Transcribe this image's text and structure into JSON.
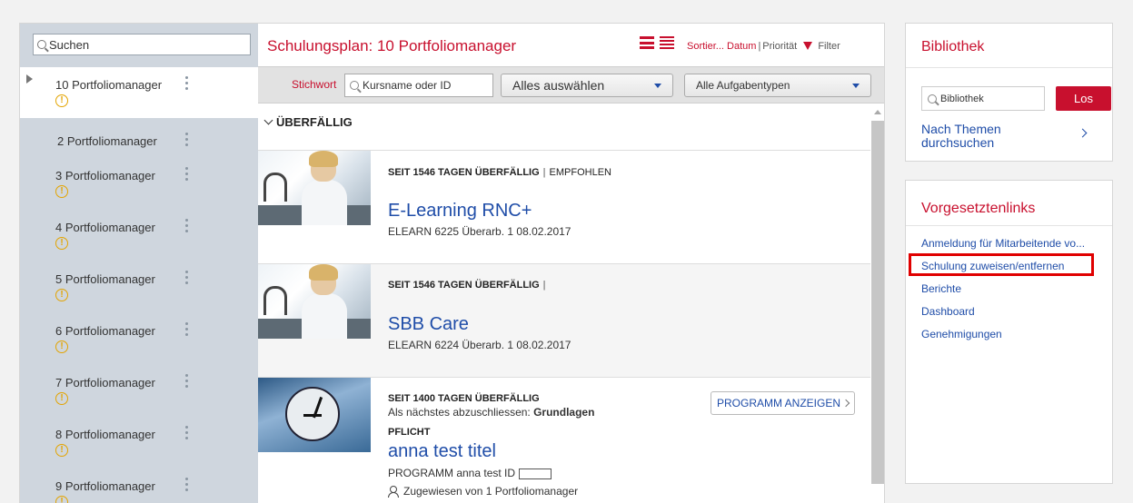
{
  "sidebar": {
    "search_placeholder": "Suchen",
    "items": [
      {
        "label": "10 Portfoliomanager",
        "warn": true,
        "active": true
      },
      {
        "label": "2 Portfoliomanager",
        "warn": false
      },
      {
        "label": "3 Portfoliomanager",
        "warn": true
      },
      {
        "label": "4 Portfoliomanager",
        "warn": true
      },
      {
        "label": "5 Portfoliomanager",
        "warn": true
      },
      {
        "label": "6 Portfoliomanager",
        "warn": true
      },
      {
        "label": "7 Portfoliomanager",
        "warn": true
      },
      {
        "label": "8 Portfoliomanager",
        "warn": true
      },
      {
        "label": "9 Portfoliomanager",
        "warn": true
      }
    ],
    "warn_glyph": "!"
  },
  "header": {
    "title": "Schulungsplan: 10 Portfoliomanager",
    "sort_label": "Sortier...",
    "sort_date": "Datum",
    "sort_priority": "Priorität",
    "filter_label": "Filter"
  },
  "toolbar": {
    "keyword_label": "Stichwort",
    "course_placeholder": "Kursname oder ID",
    "select_all": "Alles auswählen",
    "task_types": "Alle Aufgabentypen"
  },
  "section": {
    "label": "ÜBERFÄLLIG"
  },
  "courses": [
    {
      "overdue": "SEIT 1546 TAGEN ÜBERFÄLLIG",
      "sep": "|",
      "tag": "EMPFOHLEN",
      "title": "E-Learning RNC+",
      "meta": "ELEARN 6225 Überarb. 1 08.02.2017"
    },
    {
      "overdue": "SEIT 1546 TAGEN ÜBERFÄLLIG",
      "sep": "|",
      "tag": "",
      "title": "SBB Care",
      "meta": "ELEARN 6224 Überarb. 1 08.02.2017"
    },
    {
      "overdue": "SEIT 1400 TAGEN ÜBERFÄLLIG",
      "next_prefix": "Als nächstes abzuschliessen:",
      "next_value": "Grundlagen",
      "required": "PFLICHT",
      "title": "anna test titel",
      "meta": "PROGRAMM anna test ID",
      "assigned": "Zugewiesen von 1 Portfoliomanager",
      "button": "PROGRAMM ANZEIGEN"
    }
  ],
  "library": {
    "title": "Bibliothek",
    "search_placeholder": "Bibliothek",
    "go_button": "Los",
    "browse_topics": "Nach Themen durchsuchen"
  },
  "manager_links": {
    "title": "Vorgesetztenlinks",
    "items": [
      "Anmeldung für Mitarbeitende vo...",
      "Schulung zuweisen/entfernen",
      "Berichte",
      "Dashboard",
      "Genehmigungen"
    ],
    "highlighted_index": 1
  },
  "colors": {
    "brand_red": "#c8102e",
    "link_blue": "#1f4da8",
    "warning": "#e3a400",
    "highlight_box": "#e00000"
  }
}
